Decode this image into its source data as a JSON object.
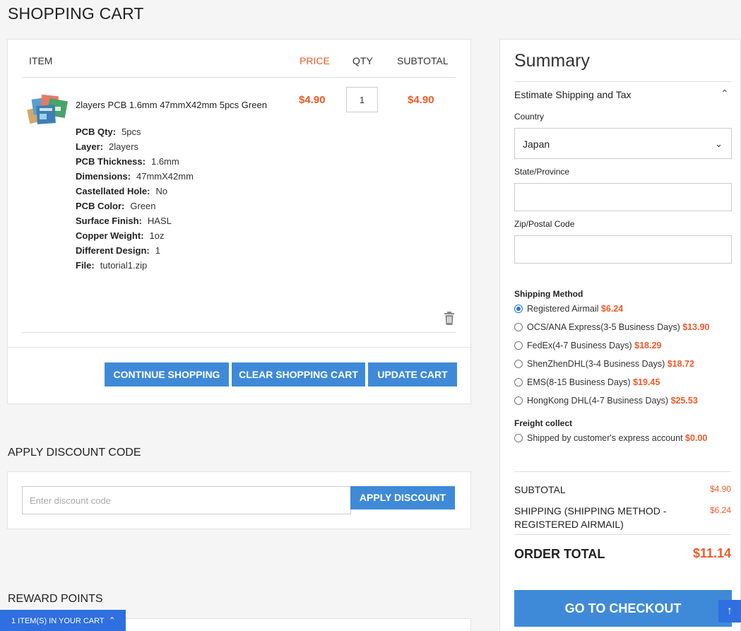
{
  "page": {
    "title": "SHOPPING CART"
  },
  "cart": {
    "headers": {
      "item": "ITEM",
      "price": "PRICE",
      "qty": "QTY",
      "subtotal": "SUBTOTAL"
    },
    "item": {
      "name": "2layers PCB 1.6mm 47mmX42mm 5pcs Green",
      "price": "$4.90",
      "qty": "1",
      "subtotal": "$4.90",
      "attributes": [
        {
          "label": "PCB Qty:",
          "value": "5pcs"
        },
        {
          "label": "Layer:",
          "value": "2layers"
        },
        {
          "label": "PCB Thickness:",
          "value": "1.6mm"
        },
        {
          "label": "Dimensions:",
          "value": "47mmX42mm"
        },
        {
          "label": "Castellated Hole:",
          "value": "No"
        },
        {
          "label": "PCB Color:",
          "value": "Green"
        },
        {
          "label": "Surface Finish:",
          "value": "HASL"
        },
        {
          "label": "Copper Weight:",
          "value": "1oz"
        },
        {
          "label": "Different Design:",
          "value": "1"
        },
        {
          "label": "File:",
          "value": "tutorial1.zip"
        }
      ]
    },
    "buttons": {
      "continue": "CONTINUE SHOPPING",
      "clear": "CLEAR SHOPPING CART",
      "update": "UPDATE CART"
    }
  },
  "discount": {
    "title": "APPLY DISCOUNT CODE",
    "placeholder": "Enter discount code",
    "button": "APPLY DISCOUNT"
  },
  "reward": {
    "title": "REWARD POINTS"
  },
  "mini_cart": {
    "label": "1 ITEM(S) IN YOUR CART"
  },
  "summary": {
    "title": "Summary",
    "estimate_title": "Estimate Shipping and Tax",
    "country_label": "Country",
    "country_value": "Japan",
    "state_label": "State/Province",
    "zip_label": "Zip/Postal Code",
    "shipping_method_title": "Shipping Method",
    "methods": [
      {
        "label": "Registered Airmail",
        "price": "$6.24",
        "selected": true
      },
      {
        "label": "OCS/ANA Express(3-5 Business Days)",
        "price": "$13.90",
        "selected": false
      },
      {
        "label": "FedEx(4-7 Business Days)",
        "price": "$18.29",
        "selected": false
      },
      {
        "label": "ShenZhenDHL(3-4 Business Days)",
        "price": "$18.72",
        "selected": false
      },
      {
        "label": "EMS(8-15 Business Days)",
        "price": "$19.45",
        "selected": false
      },
      {
        "label": "HongKong DHL(4-7 Business Days)",
        "price": "$25.53",
        "selected": false
      }
    ],
    "freight_title": "Freight collect",
    "freight": {
      "label": "Shipped by customer's express account",
      "price": "$0.00",
      "selected": false
    },
    "subtotal_label": "SUBTOTAL",
    "subtotal_value": "$4.90",
    "shipping_label_line1": "SHIPPING (SHIPPING METHOD -",
    "shipping_label_line2": "REGISTERED AIRMAIL)",
    "shipping_value": "$6.24",
    "order_total_label": "ORDER TOTAL",
    "order_total_value": "$11.14",
    "checkout_button": "GO TO CHECKOUT"
  },
  "colors": {
    "accent": "#3f8ad8",
    "price": "#f05a28",
    "floating": "#2f6fe0"
  },
  "icons": {
    "trash": "trash-icon",
    "chevron_up": "chevron-up-icon",
    "chevron_down": "chevron-down-icon",
    "scroll_top": "arrow-up-icon"
  }
}
